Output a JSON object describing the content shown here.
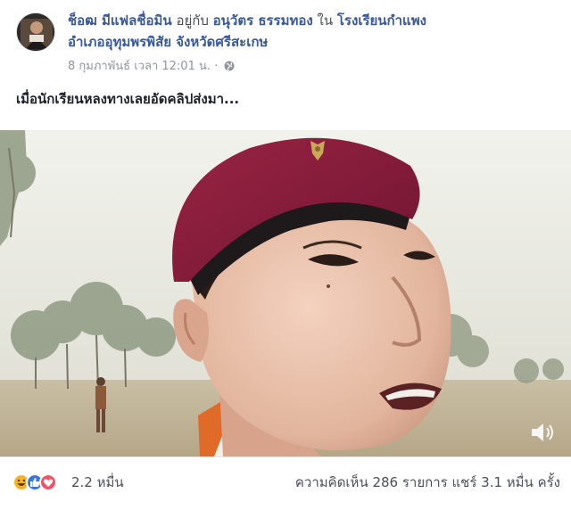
{
  "post": {
    "author": "ช็อฒ มีแฟลชื่อมิน",
    "with_word": "อยู่กับ",
    "tagged_person": "อนุวัตร ธรรมทอง",
    "in_word": "ใน",
    "location_name": "โรงเรียนกำแพง",
    "location_line2": "อำเภออุทุมพรพิสัย จังหวัดศรีสะเกษ",
    "timestamp": "8 กุมภาพันธ์ เวลา 12:01 น. ·",
    "privacy_icon": "globe-icon",
    "caption": "เมื่อนักเรียนหลงทางเลยอัดคลิปส่งมา..."
  },
  "video": {
    "mute_icon": "speaker-icon",
    "beret_color": "#8a1a38"
  },
  "footer": {
    "reaction_icons": [
      "haha-icon",
      "like-icon",
      "love-icon"
    ],
    "reaction_count": "2.2 หมื่น",
    "comments": "ความคิดเห็น 286 รายการ",
    "shares": "แชร์ 3.1 หมื่น ครั้ง"
  },
  "colors": {
    "link": "#385898",
    "muted": "#90949c",
    "like": "#3578e5",
    "love": "#f25268",
    "haha": "#f7b125"
  }
}
